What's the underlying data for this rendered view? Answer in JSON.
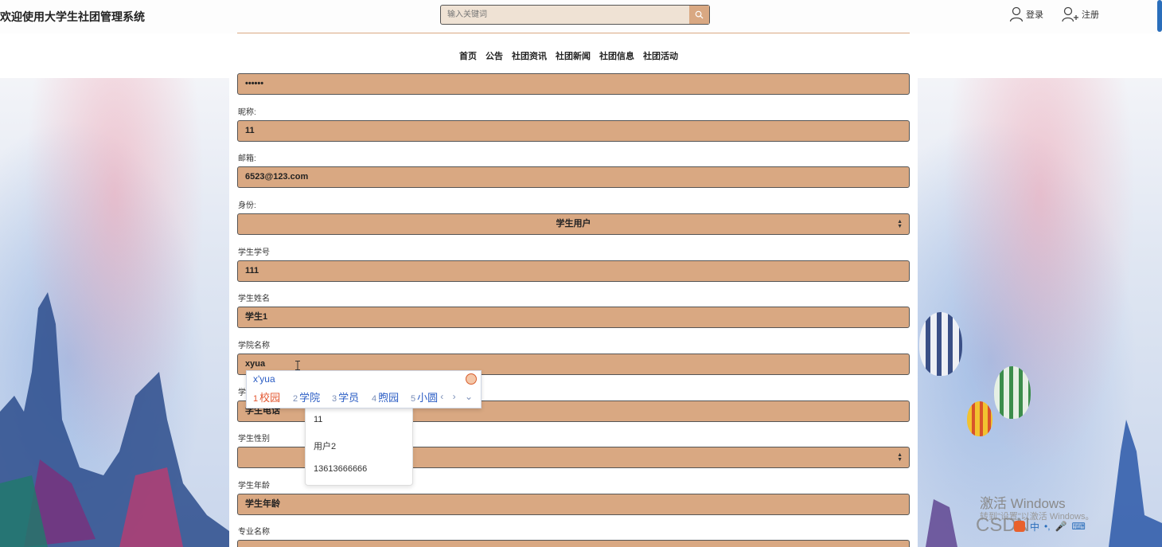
{
  "header": {
    "site_title": "欢迎使用大学生社团管理系统",
    "search_placeholder": "输入关键词",
    "login_label": "登录",
    "register_label": "注册"
  },
  "nav": {
    "items": [
      "首页",
      "公告",
      "社团资讯",
      "社团新闻",
      "社团信息",
      "社团活动"
    ]
  },
  "form": {
    "password_value": "••••••",
    "fields": {
      "nickname": {
        "label": "昵称:",
        "value": "11"
      },
      "email": {
        "label": "邮箱:",
        "value": "6523@123.com"
      },
      "role": {
        "label": "身份:",
        "value": "学生用户"
      },
      "student_no": {
        "label": "学生学号",
        "value": "111"
      },
      "student_name": {
        "label": "学生姓名",
        "value": "学生1"
      },
      "college": {
        "label": "学院名称",
        "value": "xyua"
      },
      "phone_label": "学",
      "phone": {
        "value": "学生电话"
      },
      "gender": {
        "label": "学生性别",
        "value": ""
      },
      "age": {
        "label": "学生年龄",
        "value": "学生年龄"
      },
      "major": {
        "label": "专业名称"
      }
    }
  },
  "autocomplete": [
    "11",
    "用户2",
    "13613666666"
  ],
  "ime": {
    "composition": "x'yua",
    "candidates": [
      {
        "n": "1",
        "text": "校园"
      },
      {
        "n": "2",
        "text": "学院"
      },
      {
        "n": "3",
        "text": "学员"
      },
      {
        "n": "4",
        "text": "煦园"
      },
      {
        "n": "5",
        "text": "小圆"
      }
    ],
    "nav": "‹ › ⌄"
  },
  "watermark": {
    "activate": "激活 Windows",
    "activate_sub": "转到\"设置\"以激活 Windows。",
    "csdn": "CSDN"
  },
  "colors": {
    "field_bg": "#d9a882",
    "search_bg": "#efe2d4",
    "ime_text": "#2a5cc4",
    "ime_first": "#e3552e"
  },
  "icons": {
    "search": "search-icon",
    "login": "user-icon",
    "register": "user-plus-icon",
    "select_arrow": "updown-arrow-icon"
  }
}
